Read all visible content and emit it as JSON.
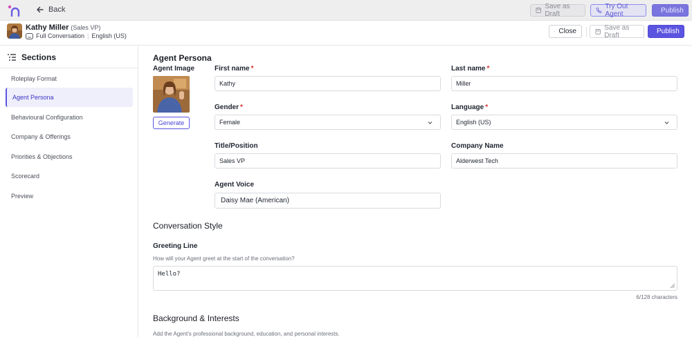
{
  "topbar": {
    "back_label": "Back",
    "save_draft_label": "Save as Draft",
    "try_out_label": "Try Out Agent",
    "publish_label": "Publish"
  },
  "header": {
    "agent_name": "Kathy Miller",
    "agent_role": "(Sales VP)",
    "mode": "Full Conversation",
    "language": "English (US)",
    "close_label": "Close",
    "save_draft_label": "Save as Draft",
    "publish_label": "Publish"
  },
  "sidebar": {
    "title": "Sections",
    "items": [
      {
        "label": "Roleplay Format",
        "active": false
      },
      {
        "label": "Agent Persona",
        "active": true
      },
      {
        "label": "Behavioural Configuration",
        "active": false
      },
      {
        "label": "Company & Offerings",
        "active": false
      },
      {
        "label": "Priorities & Objections",
        "active": false
      },
      {
        "label": "Scorecard",
        "active": false
      },
      {
        "label": "Preview",
        "active": false
      }
    ]
  },
  "persona": {
    "title": "Agent Persona",
    "image_label": "Agent Image",
    "generate_label": "Generate",
    "first_name": {
      "label": "First name",
      "required": "*",
      "value": "Kathy"
    },
    "last_name": {
      "label": "Last name",
      "required": "*",
      "value": "Miller"
    },
    "gender": {
      "label": "Gender",
      "required": "*",
      "value": "Female"
    },
    "language": {
      "label": "Language",
      "required": "*",
      "value": "English (US)"
    },
    "title_position": {
      "label": "Title/Position",
      "value": "Sales VP"
    },
    "company_name": {
      "label": "Company Name",
      "value": "Alderwest Tech"
    },
    "voice": {
      "label": "Agent Voice",
      "value": "Daisy Mae (American)"
    }
  },
  "conversation": {
    "title": "Conversation Style",
    "greeting_label": "Greeting Line",
    "greeting_help": "How will your Agent greet at the start of the conversation?",
    "greeting_value": "Hello?",
    "counter": "6/128 characters"
  },
  "background": {
    "title": "Background & Interests",
    "help": "Add the Agent's professional background, education, and personal interests."
  },
  "colors": {
    "accent": "#5b54e0",
    "required": "#d93030"
  }
}
